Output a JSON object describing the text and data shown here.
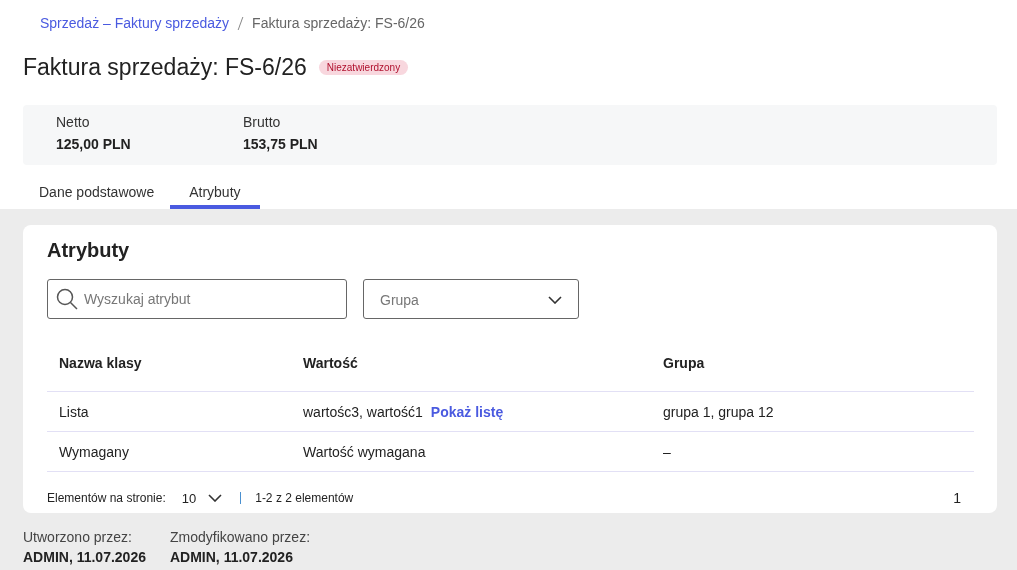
{
  "breadcrumb": [
    {
      "label": "Sprzedaż – Faktury sprzedaży",
      "kind": "link"
    },
    {
      "label": "Faktura sprzedaży: FS-6/26",
      "kind": "current"
    }
  ],
  "title": "Faktura sprzedaży: FS-6/26",
  "status_badge": "Niezatwierdzony",
  "summary": [
    {
      "label": "Netto",
      "value": "125,00 PLN"
    },
    {
      "label": "Brutto",
      "value": "153,75 PLN"
    }
  ],
  "tabs": [
    {
      "label": "Dane podstawowe",
      "selected": false
    },
    {
      "label": "Atrybuty",
      "selected": true
    }
  ],
  "card": {
    "title": "Atrybuty",
    "search": {
      "placeholder": "Wyszukaj atrybut"
    },
    "group_select": {
      "placeholder": "Grupa"
    },
    "table": {
      "columns": [
        "Nazwa klasy",
        "Wartość",
        "Grupa"
      ],
      "rows": [
        {
          "name": "Lista",
          "value": "wartośc3, wartość1",
          "link": "Pokaż listę",
          "group": "grupa 1, grupa 12"
        },
        {
          "name": "Wymagany",
          "value": "Wartość wymagana",
          "group": "–"
        }
      ]
    },
    "pagination": {
      "label": "Elementów na stronie:",
      "page_size": "10",
      "range": "1-2 z 2 elementów",
      "page": "1"
    }
  },
  "footer": [
    {
      "label": "Utworzono przez:",
      "value": "ADMIN, 11.07.2026"
    },
    {
      "label": "Zmodyfikowano przez:",
      "value": "ADMIN, 11.07.2026"
    }
  ]
}
